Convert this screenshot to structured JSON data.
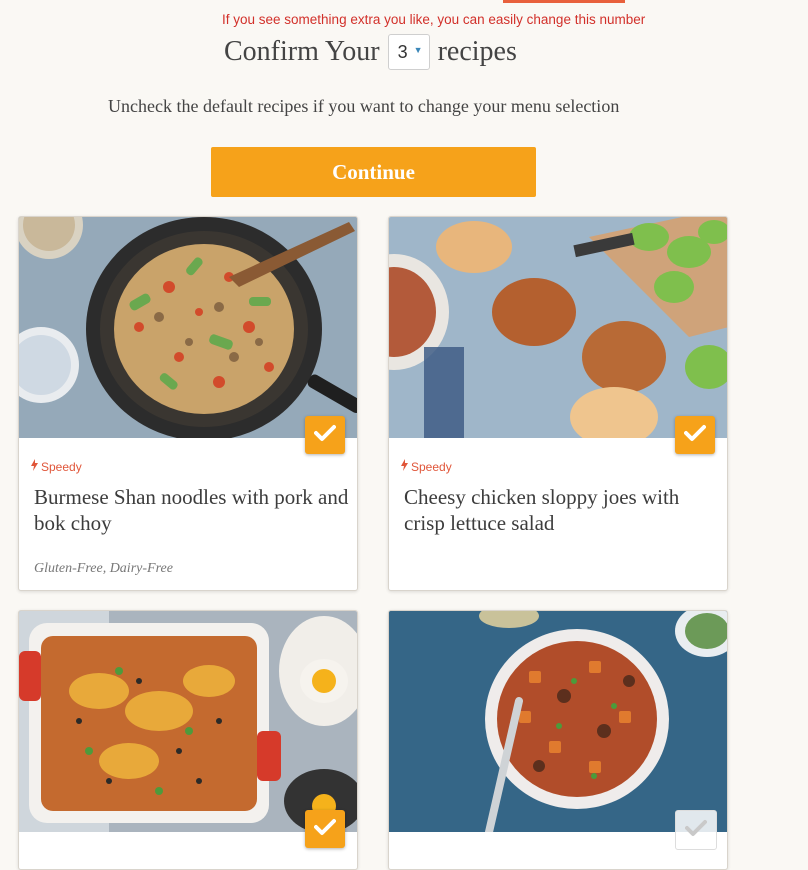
{
  "header": {
    "hint_text": "If you see something extra you like, you can easily change this number",
    "title_prefix": "Confirm Your",
    "quantity_value": "3",
    "title_suffix": "recipes",
    "subtitle": "Uncheck the default recipes if you want to change your menu selection",
    "continue_label": "Continue"
  },
  "colors": {
    "accent_orange": "#f6a21a",
    "hint_red": "#d2302a",
    "badge_red": "#e0563a"
  },
  "recipes": [
    {
      "badge": "Speedy",
      "title": "Burmese Shan noodles with pork and bok choy",
      "tag1": "Gluten-Free",
      "tag2": "Dairy-Free",
      "checked": true
    },
    {
      "badge": "Speedy",
      "title": "Cheesy chicken sloppy joes with crisp lettuce salad",
      "checked": true
    },
    {
      "checked": true
    },
    {
      "checked": false
    }
  ]
}
